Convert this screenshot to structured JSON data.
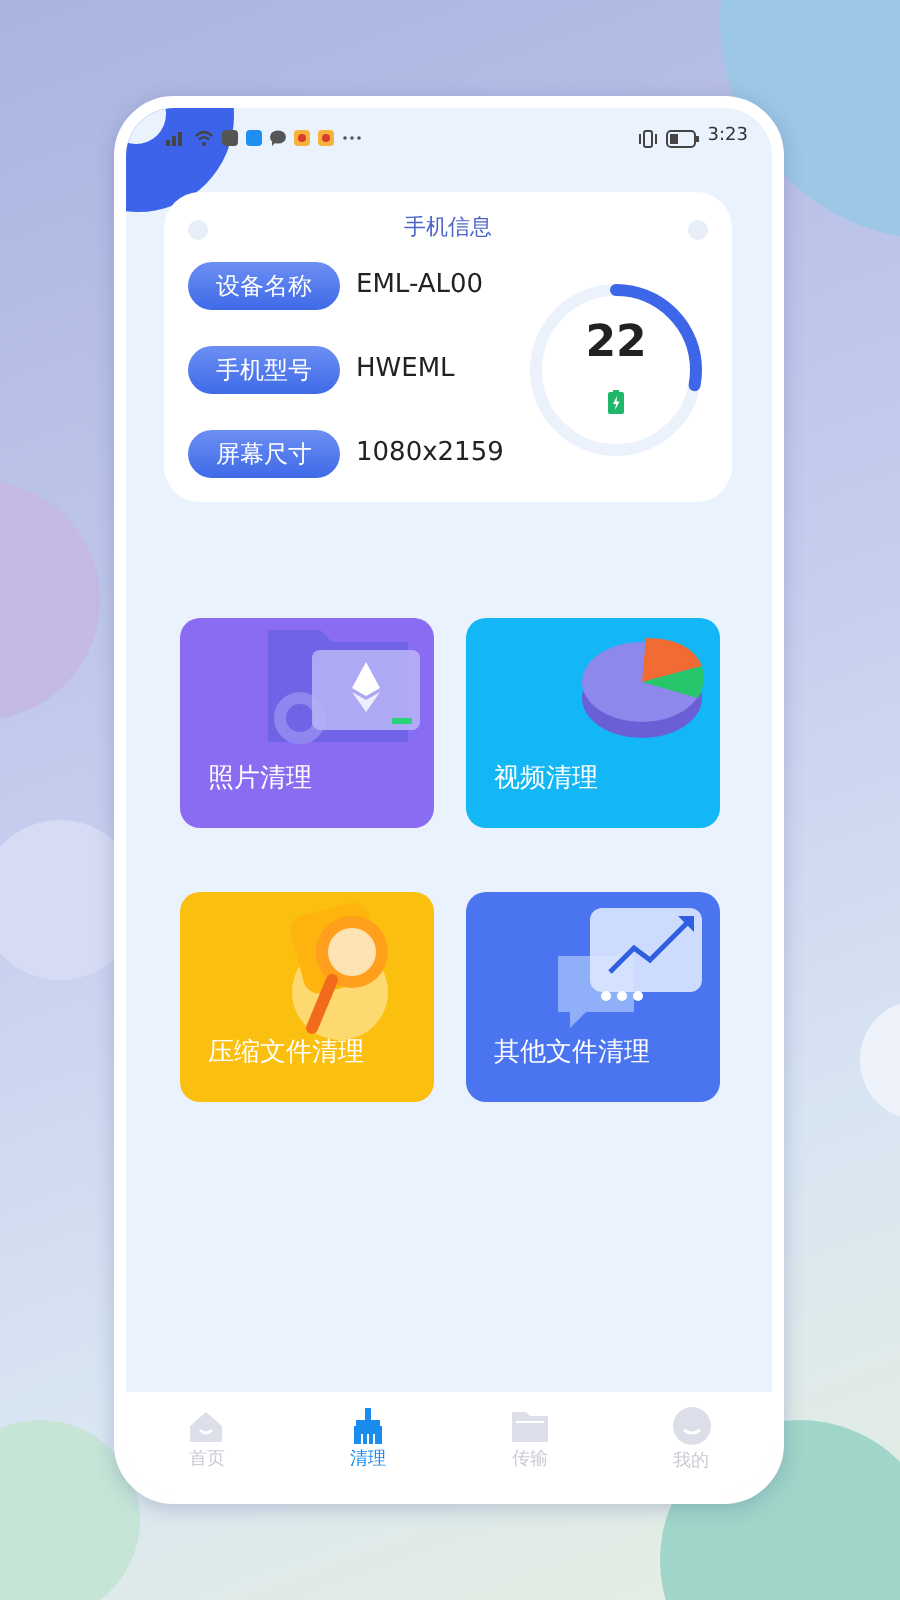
{
  "status_bar": {
    "time": "3:23"
  },
  "phone_info": {
    "title": "手机信息",
    "rows": [
      {
        "label": "设备名称",
        "value": "EML-AL00"
      },
      {
        "label": "手机型号",
        "value": "HWEML"
      },
      {
        "label": "屏幕尺寸",
        "value": "1080x2159"
      }
    ],
    "gauge": {
      "reading": "22",
      "level": 0.28
    }
  },
  "tiles": [
    {
      "label": "照片清理",
      "kind": "folder",
      "color": "#8a6cf2"
    },
    {
      "label": "视频清理",
      "kind": "pie",
      "color": "#14b7f5"
    },
    {
      "label": "压缩文件清理",
      "kind": "magnifier",
      "color": "#fbbf0f"
    },
    {
      "label": "其他文件清理",
      "kind": "chart",
      "color": "#4a74f0"
    }
  ],
  "tabs": [
    {
      "label": "首页",
      "kind": "home",
      "selected": false
    },
    {
      "label": "清理",
      "kind": "broom",
      "selected": true
    },
    {
      "label": "传输",
      "kind": "folder",
      "selected": false
    },
    {
      "label": "我的",
      "kind": "face",
      "selected": false
    }
  ]
}
